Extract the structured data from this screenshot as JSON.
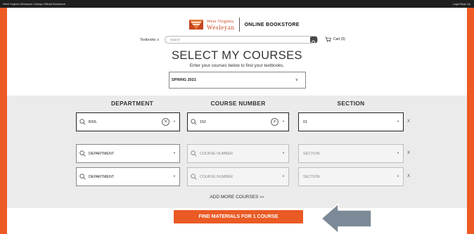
{
  "topbar": {
    "left": "West Virginia Wesleyan College Official Bookstore",
    "right": "Login/Sign Up"
  },
  "brand": {
    "line1": "West Virginia",
    "line2": "Wesleyan",
    "store": "ONLINE BOOKSTORE"
  },
  "nav": {
    "textbooks": "Textbooks ∨",
    "search_placeholder": "Search",
    "cart": "Cart (0)"
  },
  "page": {
    "title": "SELECT MY COURSES",
    "subtitle": "Enter your courses below to find your textbooks."
  },
  "term": {
    "value": "SPRING 2021"
  },
  "columns": {
    "department": "DEPARTMENT",
    "course": "COURSE NUMBER",
    "section": "SECTION"
  },
  "rows": [
    {
      "department": "BIOL",
      "course": "152",
      "section": "01"
    },
    {
      "department": "DEPARTMENT",
      "course": "COURSE NUMBER",
      "section": "SECTION"
    },
    {
      "department": "DEPARTMENT",
      "course": "COURSE NUMBER",
      "section": "SECTION"
    }
  ],
  "remove_label": "X",
  "add_more": "ADD MORE COURSES ›››",
  "find_button": "FIND MATERIALS FOR 1 COURSE",
  "colors": {
    "accent": "#ea5a24",
    "panel": "#ebebeb",
    "arrow": "#7b8a96"
  }
}
